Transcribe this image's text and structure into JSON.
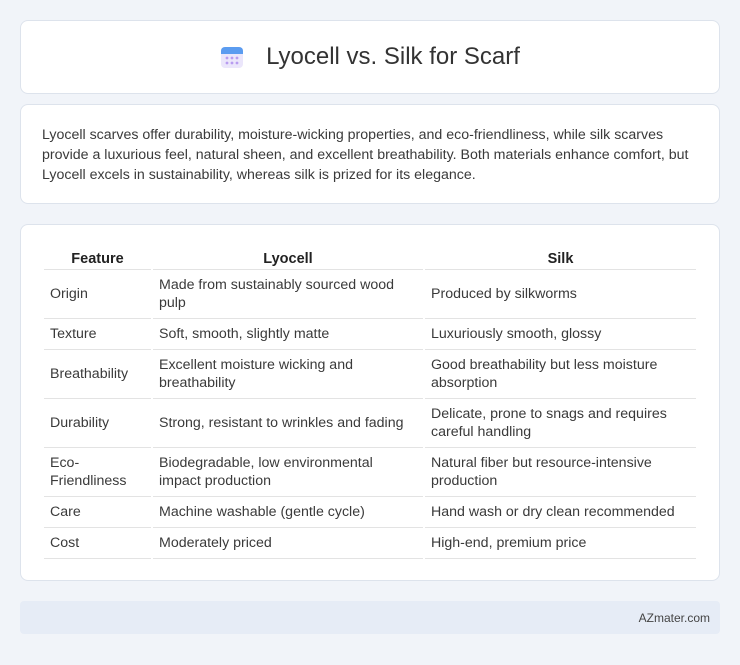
{
  "header": {
    "title": "Lyocell vs. Silk for Scarf",
    "icon": "calendar-icon"
  },
  "intro": {
    "text": "Lyocell scarves offer durability, moisture-wicking properties, and eco-friendliness, while silk scarves provide a luxurious feel, natural sheen, and excellent breathability. Both materials enhance comfort, but Lyocell excels in sustainability, whereas silk is prized for its elegance."
  },
  "table": {
    "columns": [
      "Feature",
      "Lyocell",
      "Silk"
    ],
    "rows": [
      {
        "feature": "Origin",
        "lyocell": "Made from sustainably sourced wood pulp",
        "silk": "Produced by silkworms"
      },
      {
        "feature": "Texture",
        "lyocell": "Soft, smooth, slightly matte",
        "silk": "Luxuriously smooth, glossy"
      },
      {
        "feature": "Breathability",
        "lyocell": "Excellent moisture wicking and breathability",
        "silk": "Good breathability but less moisture absorption"
      },
      {
        "feature": "Durability",
        "lyocell": "Strong, resistant to wrinkles and fading",
        "silk": "Delicate, prone to snags and requires careful handling"
      },
      {
        "feature": "Eco-Friendliness",
        "lyocell": "Biodegradable, low environmental impact production",
        "silk": "Natural fiber but resource-intensive production"
      },
      {
        "feature": "Care",
        "lyocell": "Machine washable (gentle cycle)",
        "silk": "Hand wash or dry clean recommended"
      },
      {
        "feature": "Cost",
        "lyocell": "Moderately priced",
        "silk": "High-end, premium price"
      }
    ]
  },
  "footer": {
    "text": "AZmater.com"
  }
}
